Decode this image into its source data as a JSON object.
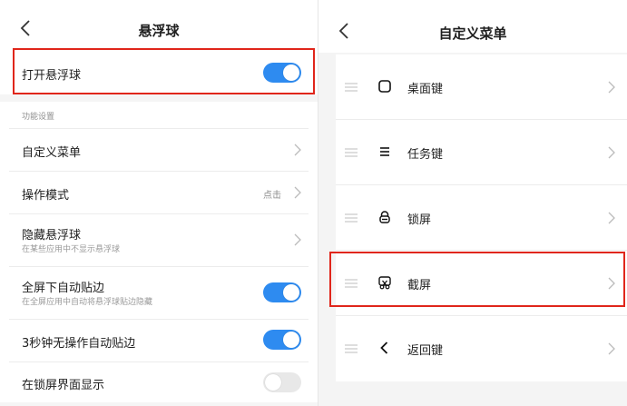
{
  "colors": {
    "accent": "#2e8bf0",
    "highlight": "#e0261b",
    "toggle_off": "#e8e8e8"
  },
  "left": {
    "header": {
      "title": "悬浮球",
      "back_icon": "chevron-left-icon"
    },
    "main_toggle": {
      "label": "打开悬浮球",
      "on": true
    },
    "section_label": "功能设置",
    "items": [
      {
        "title": "自定义菜单",
        "chevron": true
      },
      {
        "title": "操作模式",
        "value": "点击",
        "chevron": true
      },
      {
        "title": "隐藏悬浮球",
        "subtitle": "在某些应用中不显示悬浮球",
        "chevron": true
      },
      {
        "title": "全屏下自动贴边",
        "subtitle": "在全屏应用中自动将悬浮球贴边隐藏",
        "toggle": true
      },
      {
        "title": "3秒钟无操作自动贴边",
        "toggle": true
      },
      {
        "title": "在锁屏界面显示",
        "toggle": false
      }
    ]
  },
  "right": {
    "header": {
      "title": "自定义菜单",
      "back_icon": "chevron-left-icon"
    },
    "menu_items": [
      {
        "label": "桌面键",
        "icon": "home-square-icon"
      },
      {
        "label": "任务键",
        "icon": "menu-lines-icon"
      },
      {
        "label": "锁屏",
        "icon": "lock-icon"
      },
      {
        "label": "截屏",
        "icon": "screenshot-scissors-icon"
      },
      {
        "label": "返回键",
        "icon": "back-arrow-icon"
      }
    ]
  }
}
